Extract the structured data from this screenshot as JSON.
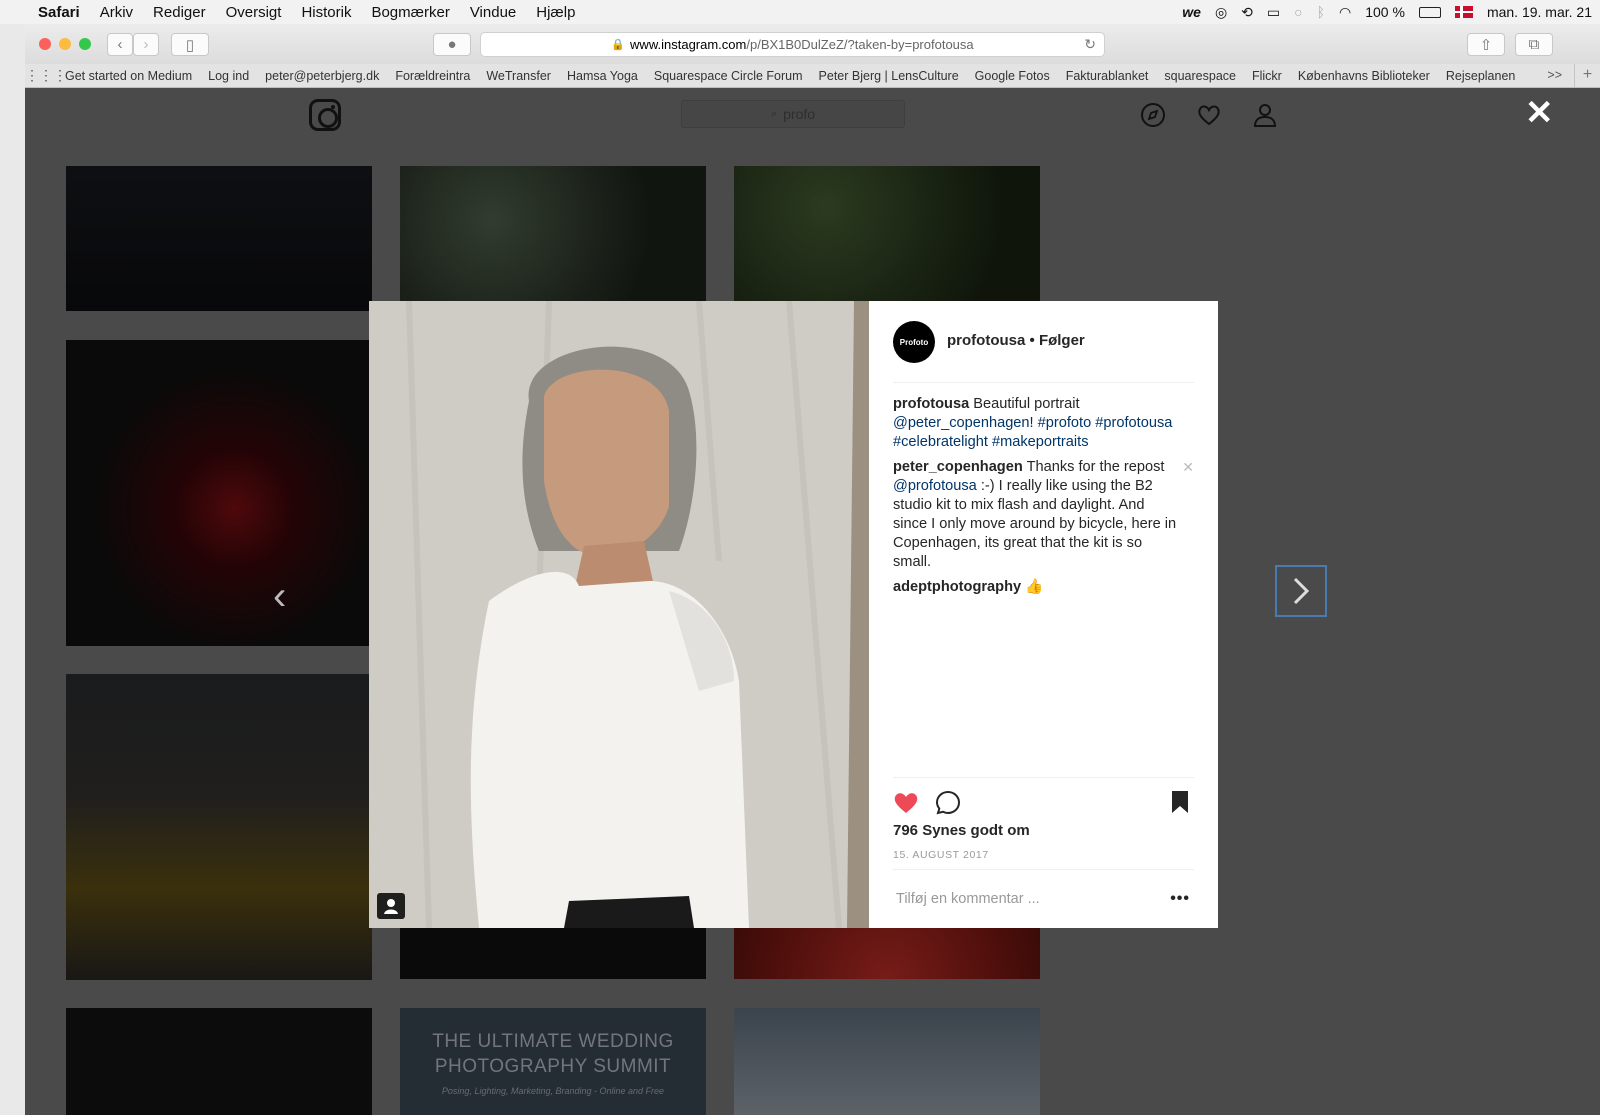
{
  "menubar": {
    "app": "Safari",
    "items": [
      "Arkiv",
      "Rediger",
      "Oversigt",
      "Historik",
      "Bogmærker",
      "Vindue",
      "Hjælp"
    ],
    "battery": "100 %",
    "datetime": "man. 19. mar. 21"
  },
  "browser": {
    "url_host": "www.instagram.com",
    "url_path": "/p/BX1B0DulZeZ/?taken-by=profotousa",
    "bookmarks": [
      "Get started on Medium",
      "Log ind",
      "peter@peterbjerg.dk",
      "Forældreintra",
      "WeTransfer",
      "Hamsa Yoga",
      "Squarespace Circle Forum",
      "Peter Bjerg | LensCulture",
      "Google Fotos",
      "Fakturablanket",
      "squarespace",
      "Flickr",
      "Københavns Biblioteker",
      "Rejseplanen"
    ],
    "bookmarks_more": ">>"
  },
  "instagram": {
    "search_placeholder": "profo",
    "grid_text": {
      "line1": "THE ULTIMATE WEDDING",
      "line2": "PHOTOGRAPHY SUMMIT",
      "line3": "Posing, Lighting, Marketing, Branding - Online and Free"
    }
  },
  "post": {
    "avatar_text": "Profoto",
    "username": "profotousa",
    "separator": "•",
    "follow_status": "Følger",
    "comments": [
      {
        "user": "profotousa",
        "text": "Beautiful portrait",
        "link": "@peter_copenhagen",
        "after": "!",
        "tags": "#profoto #profotousa #celebratelight #makeportraits"
      },
      {
        "user": "peter_copenhagen",
        "text1": "Thanks for the repost",
        "link": "@profotousa",
        "text2": ":-) I really like using the B2 studio kit to mix flash and daylight. And since I only move around by bicycle, here in Copenhagen, its great that the kit is so small."
      },
      {
        "user": "adeptphotography",
        "emoji": "👍"
      }
    ],
    "likes": "796 Synes godt om",
    "date": "15. AUGUST 2017",
    "comment_placeholder": "Tilføj en kommentar ...",
    "more": "•••"
  }
}
